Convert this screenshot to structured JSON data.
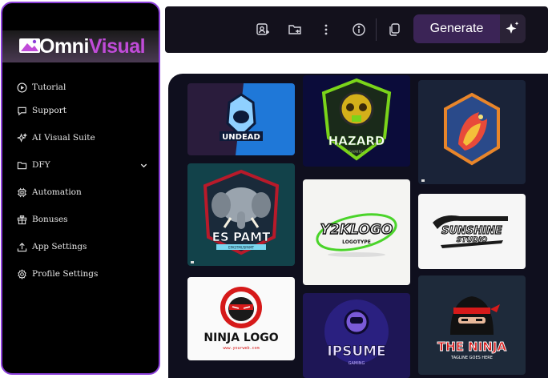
{
  "brand": {
    "name_part1": "Omni",
    "name_part2": "Visual"
  },
  "sidebar": {
    "items": [
      {
        "label": "Tutorial",
        "icon": "play-circle-icon"
      },
      {
        "label": "Support",
        "icon": "chat-bubble-icon"
      },
      {
        "label": "AI Visual Suite",
        "icon": "sparkles-icon"
      },
      {
        "label": "DFY",
        "icon": "folder-icon",
        "expandable": true
      },
      {
        "label": "Automation",
        "icon": "cpu-icon"
      },
      {
        "label": "Bonuses",
        "icon": "gift-icon"
      },
      {
        "label": "App Settings",
        "icon": "upload-icon"
      },
      {
        "label": "Profile Settings",
        "icon": "gear-icon"
      }
    ]
  },
  "toolbar": {
    "icons": [
      "image-user-icon",
      "folder-save-icon",
      "more-vertical-icon",
      "info-icon",
      "copy-icon"
    ],
    "generate_label": "Generate",
    "generate_icon": "sparkles-icon"
  },
  "gallery": {
    "logos": [
      {
        "text": "UNDEAD",
        "sub": ""
      },
      {
        "text": "HAZARD",
        "sub": "GAMING"
      },
      {
        "text": "",
        "sub": ""
      },
      {
        "text": "ES PAMT",
        "sub": "EPASTMUSPAMT"
      },
      {
        "text": "Y2KLOGO",
        "sub": "LOGOTYPE"
      },
      {
        "text": "SUNSHINE",
        "sub": "STUDIO"
      },
      {
        "text": "NINJA LOGO",
        "sub": "www.yourweb.com"
      },
      {
        "text": "IPSUME",
        "sub": "GAMING"
      },
      {
        "text": "THE NINJA",
        "sub": "TAGLINE GOES HERE"
      }
    ]
  },
  "colors": {
    "accent": "#8b3fd9",
    "brand_accent": "#c04bd8",
    "generate_bg": "#3b2456",
    "gallery_bg": "#0f0f1e"
  }
}
